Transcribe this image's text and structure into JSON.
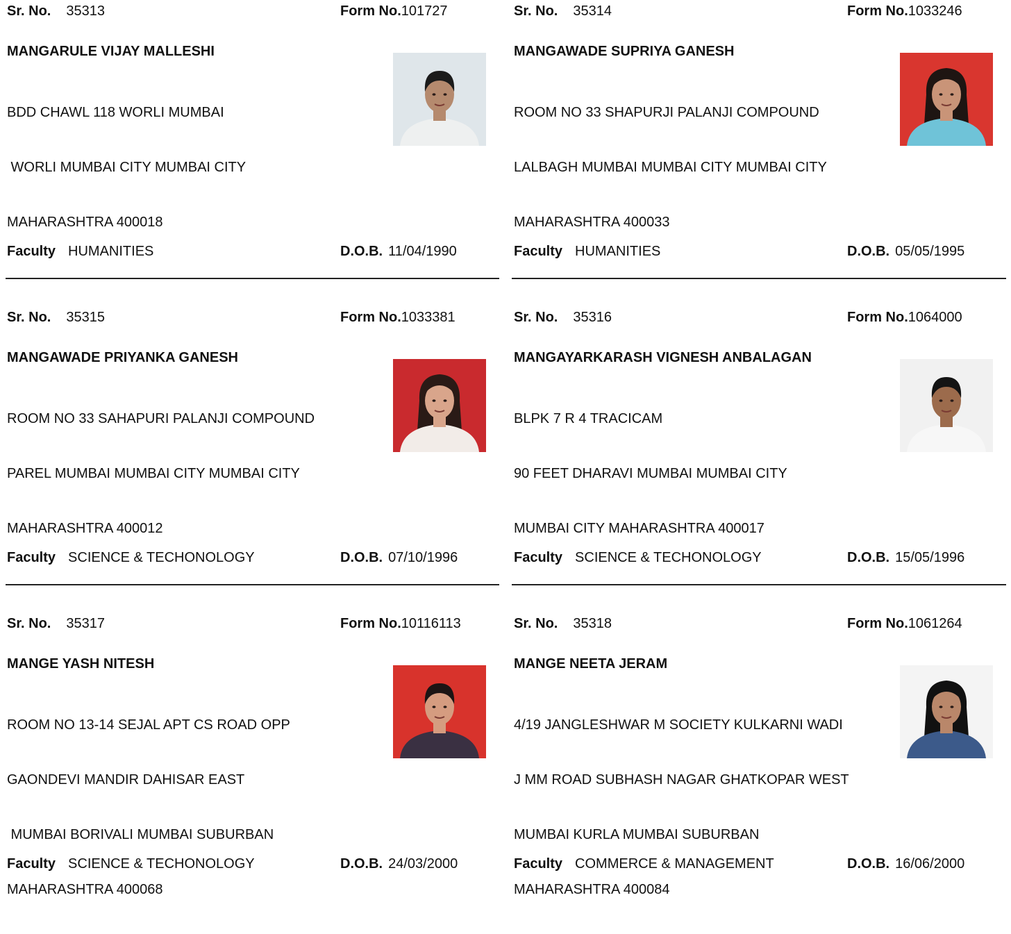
{
  "labels": {
    "sr_no": "Sr. No.",
    "form_no": "Form No.",
    "faculty": "Faculty",
    "dob": "D.O.B."
  },
  "records": [
    {
      "sr_no": "35313",
      "form_no": "101727",
      "name": "MANGARULE VIJAY MALLESHI",
      "address": [
        "BDD CHAWL 118 WORLI MUMBAI",
        " WORLI MUMBAI CITY MUMBAI CITY",
        "MAHARASHTRA 400018"
      ],
      "faculty": "HUMANITIES",
      "dob": "11/04/1990"
    },
    {
      "sr_no": "35314",
      "form_no": "1033246",
      "name": "MANGAWADE SUPRIYA GANESH",
      "address": [
        "ROOM NO 33 SHAPURJI PALANJI COMPOUND",
        "LALBAGH MUMBAI MUMBAI CITY MUMBAI CITY",
        "MAHARASHTRA 400033"
      ],
      "faculty": "HUMANITIES",
      "dob": "05/05/1995"
    },
    {
      "sr_no": "35315",
      "form_no": "1033381",
      "name": "MANGAWADE PRIYANKA GANESH",
      "address": [
        "ROOM NO 33 SAHAPURI PALANJI COMPOUND",
        "PAREL MUMBAI MUMBAI CITY MUMBAI CITY",
        "MAHARASHTRA 400012"
      ],
      "faculty": "SCIENCE & TECHONOLOGY",
      "dob": "07/10/1996"
    },
    {
      "sr_no": "35316",
      "form_no": "1064000",
      "name": "MANGAYARKARASH VIGNESH ANBALAGAN",
      "address": [
        "BLPK 7 R 4 TRACICAM",
        "90 FEET DHARAVI MUMBAI MUMBAI CITY",
        "MUMBAI CITY MAHARASHTRA 400017"
      ],
      "faculty": "SCIENCE & TECHONOLOGY",
      "dob": "15/05/1996"
    },
    {
      "sr_no": "35317",
      "form_no": "10116113",
      "name": "MANGE YASH NITESH",
      "address": [
        "ROOM NO 13-14 SEJAL APT CS ROAD OPP",
        "GAONDEVI MANDIR DAHISAR EAST",
        " MUMBAI BORIVALI MUMBAI SUBURBAN",
        "MAHARASHTRA 400068"
      ],
      "faculty": "SCIENCE & TECHONOLOGY",
      "dob": "24/03/2000"
    },
    {
      "sr_no": "35318",
      "form_no": "1061264",
      "name": "MANGE NEETA JERAM",
      "address": [
        "4/19 JANGLESHWAR M SOCIETY KULKARNI WADI",
        "J MM ROAD SUBHASH NAGAR GHATKOPAR WEST",
        "MUMBAI KURLA MUMBAI SUBURBAN",
        "MAHARASHTRA 400084"
      ],
      "faculty": "COMMERCE & MANAGEMENT",
      "dob": "16/06/2000"
    }
  ],
  "photo_styles": [
    {
      "bg": "#dfe6ea",
      "shirt": "#eef0f0",
      "skin": "#b58a6e",
      "hair": "#1b1b1b",
      "long_hair": false
    },
    {
      "bg": "#d9362f",
      "shirt": "#6fc3d8",
      "skin": "#c99478",
      "hair": "#1e1512",
      "long_hair": true
    },
    {
      "bg": "#c92a2e",
      "shirt": "#f2ece8",
      "skin": "#d9a58b",
      "hair": "#2a1a16",
      "long_hair": true
    },
    {
      "bg": "#f1f1f1",
      "shirt": "#f7f7f7",
      "skin": "#9c6b4c",
      "hair": "#141414",
      "long_hair": false
    },
    {
      "bg": "#d8332c",
      "shirt": "#3a3042",
      "skin": "#d59c80",
      "hair": "#1c1414",
      "long_hair": false
    },
    {
      "bg": "#f4f4f4",
      "shirt": "#3c5a8a",
      "skin": "#b9876a",
      "hair": "#111111",
      "long_hair": true
    }
  ]
}
